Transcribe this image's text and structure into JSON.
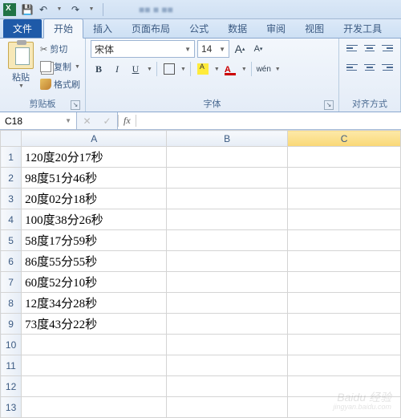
{
  "qat": {
    "save": "💾",
    "undo": "↶",
    "redo": "↷"
  },
  "tabs": {
    "file": "文件",
    "items": [
      "开始",
      "插入",
      "页面布局",
      "公式",
      "数据",
      "审阅",
      "视图",
      "开发工具"
    ],
    "active_index": 0
  },
  "ribbon": {
    "clipboard": {
      "paste": "粘贴",
      "cut": "剪切",
      "copy": "复制",
      "format_painter": "格式刷",
      "group_label": "剪贴板"
    },
    "font": {
      "name": "宋体",
      "size": "14",
      "grow": "A",
      "shrink": "A",
      "bold": "B",
      "italic": "I",
      "underline": "U",
      "group_label": "字体"
    },
    "align": {
      "group_label": "对齐方式"
    }
  },
  "namebox": {
    "ref": "C18"
  },
  "formula": {
    "fx": "fx",
    "value": ""
  },
  "columns": [
    "A",
    "B",
    "C"
  ],
  "rows": [
    {
      "n": 1,
      "A": "120度20分17秒"
    },
    {
      "n": 2,
      "A": "98度51分46秒"
    },
    {
      "n": 3,
      "A": "20度02分18秒"
    },
    {
      "n": 4,
      "A": "100度38分26秒"
    },
    {
      "n": 5,
      "A": "58度17分59秒"
    },
    {
      "n": 6,
      "A": "86度55分55秒"
    },
    {
      "n": 7,
      "A": "60度52分10秒"
    },
    {
      "n": 8,
      "A": "12度34分28秒"
    },
    {
      "n": 9,
      "A": "73度43分22秒"
    },
    {
      "n": 10,
      "A": ""
    },
    {
      "n": 11,
      "A": ""
    },
    {
      "n": 12,
      "A": ""
    },
    {
      "n": 13,
      "A": ""
    }
  ],
  "selected_column": "C",
  "watermark": {
    "main": "Baidu 经验",
    "sub": "jingyan.baidu.com"
  }
}
